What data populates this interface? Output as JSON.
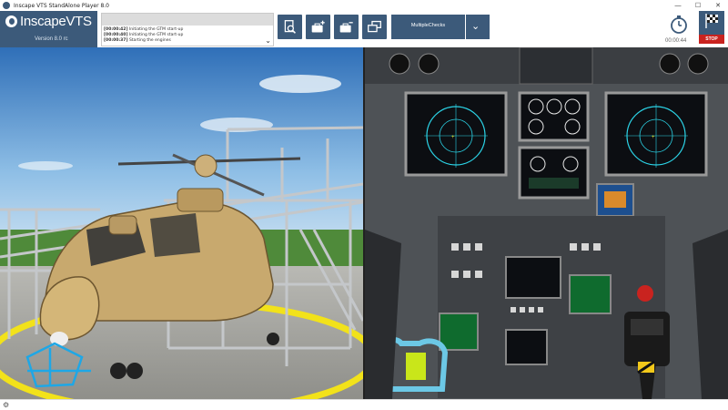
{
  "window": {
    "title": "Inscape VTS StandAlone Player 8.0",
    "controls": {
      "minimize": "—",
      "maximize": "☐",
      "close": "✕"
    }
  },
  "logo": {
    "text": "InscapeVTS",
    "version": "Version 8.0 rc"
  },
  "log": {
    "lines": [
      {
        "time": "[00:00:42]",
        "message": "Initiating the GTM start-up"
      },
      {
        "time": "[00:00:40]",
        "message": "Initiating the GTM start-up"
      },
      {
        "time": "[00:00:37]",
        "message": "Starting the engines"
      }
    ],
    "expand_icon": "chevron-down-icon"
  },
  "toolbar": {
    "buttons": [
      {
        "icon": "document-search-icon"
      },
      {
        "icon": "toolbox-add-icon"
      },
      {
        "icon": "toolbox-remove-icon"
      },
      {
        "icon": "windows-icon"
      }
    ],
    "dropdown": {
      "selected": "MultipleChecks",
      "icon": "chevron-down-icon"
    }
  },
  "session": {
    "timer": "00:00:44",
    "stop_label": "STOP",
    "stop_icon": "checkered-flag-icon"
  },
  "colors": {
    "accent": "#3c5a7a",
    "stop": "#c9231f",
    "helipad_line": "#f2e21a",
    "helicopter_body": "#c8a96e",
    "cockpit_screen": "#0b2a1c"
  },
  "scene": {
    "left_view": "helicopter-on-helipad",
    "right_view": "cockpit-instrument-panel"
  },
  "status": {
    "settings_icon": "gear-icon"
  }
}
